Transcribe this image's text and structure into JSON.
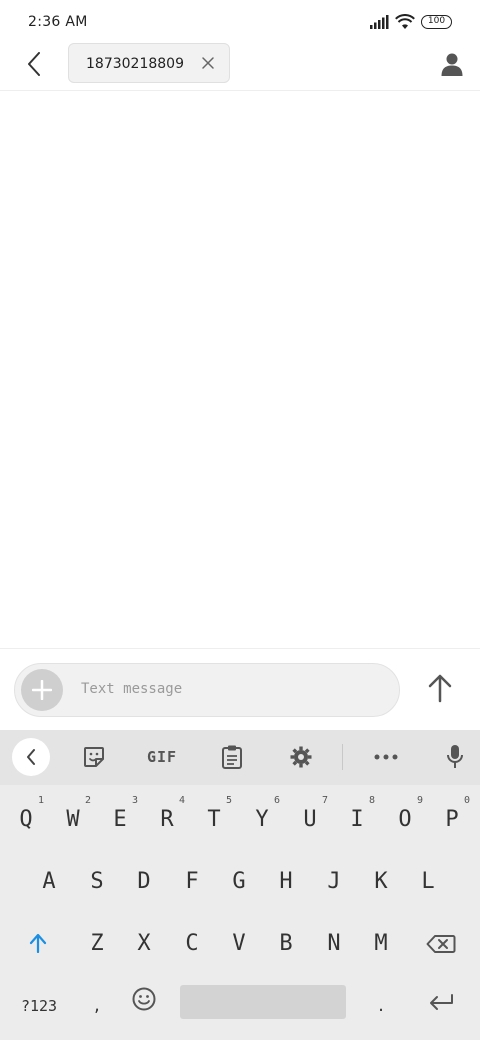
{
  "status": {
    "time": "2:36 AM",
    "battery": "100",
    "icons": [
      "signal-icon",
      "wifi-icon",
      "battery-icon"
    ]
  },
  "header": {
    "back_icon": "back-arrow-icon",
    "recipient": "18730218809",
    "chip_close_icon": "close-icon",
    "contact_icon": "person-icon"
  },
  "compose": {
    "placeholder": "Text message",
    "attach_icon": "plus-icon",
    "send_icon": "arrow-up-icon"
  },
  "keyboard": {
    "toolbar": {
      "items": [
        "collapse-icon",
        "sticker-icon",
        "GIF",
        "clipboard-icon",
        "gear-icon",
        "more-icon",
        "mic-icon"
      ],
      "gif_label": "GIF"
    },
    "row1": [
      "Q",
      "W",
      "E",
      "R",
      "T",
      "Y",
      "U",
      "I",
      "O",
      "P"
    ],
    "row1_hints": [
      "1",
      "2",
      "3",
      "4",
      "5",
      "6",
      "7",
      "8",
      "9",
      "0"
    ],
    "row2": [
      "A",
      "S",
      "D",
      "F",
      "G",
      "H",
      "J",
      "K",
      "L"
    ],
    "row3": [
      "Z",
      "X",
      "C",
      "V",
      "B",
      "N",
      "M"
    ],
    "row4": {
      "symbols": "?123",
      "comma": ",",
      "period": "."
    },
    "accent_color": "#1a8fe3"
  }
}
